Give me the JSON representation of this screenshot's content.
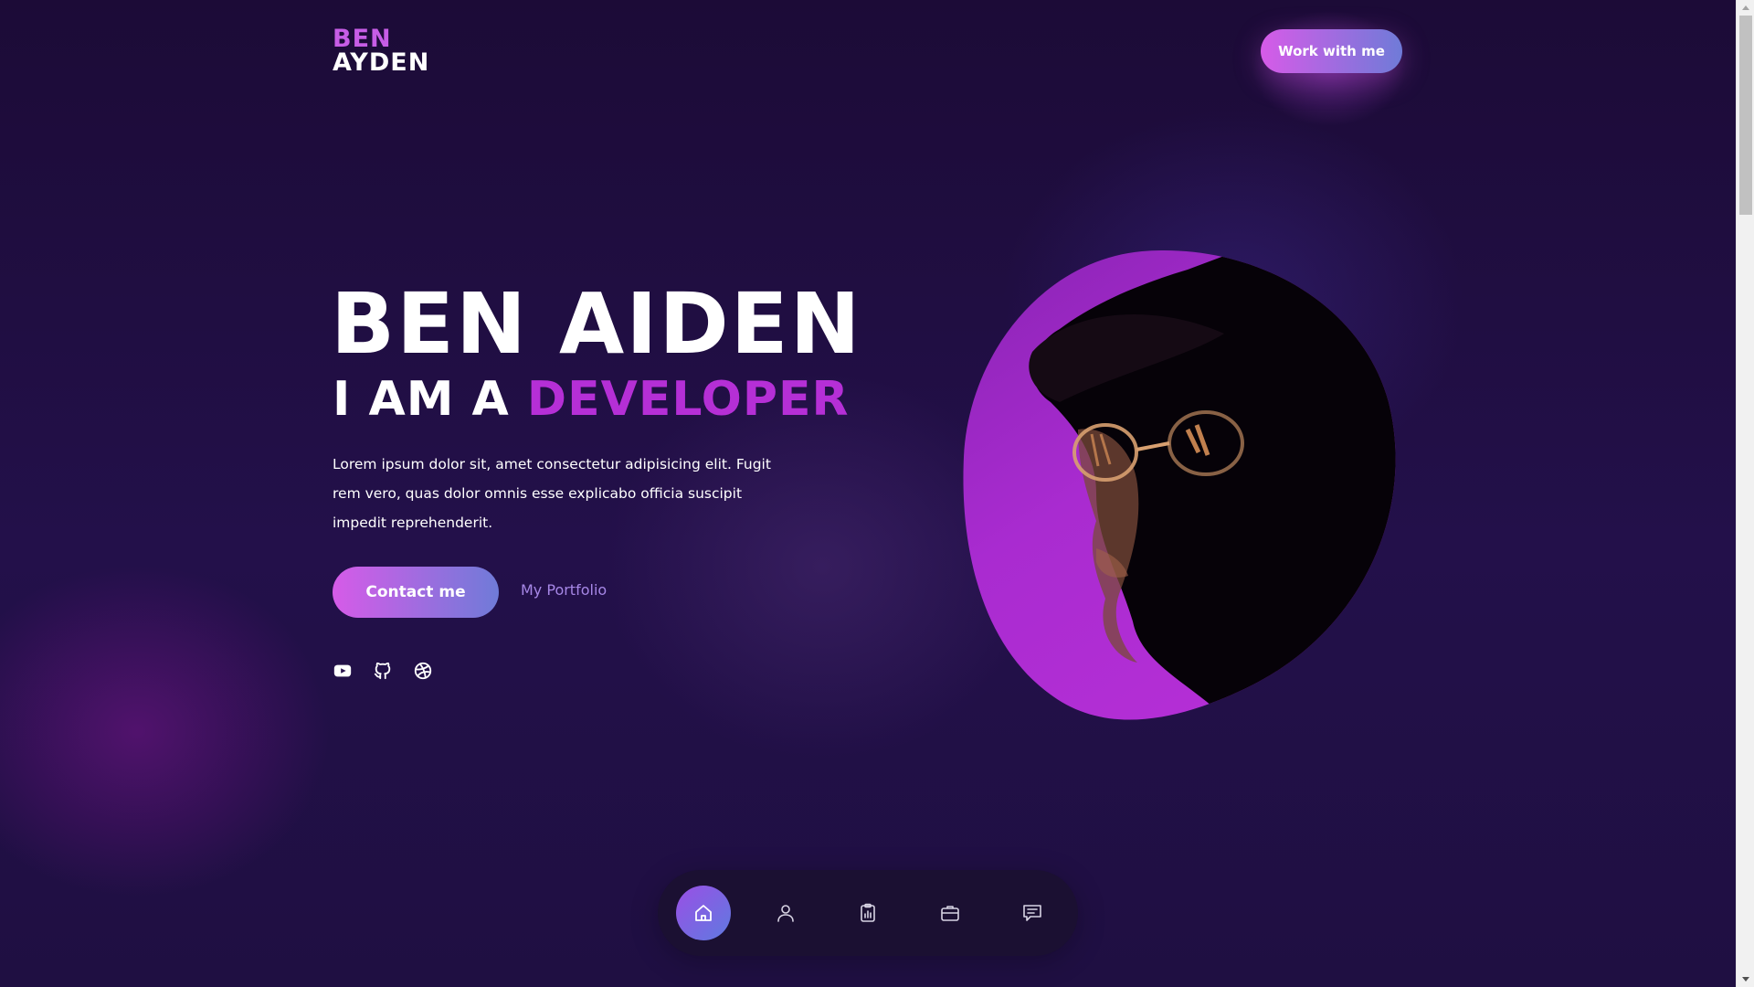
{
  "header": {
    "logo_first": "BEN",
    "logo_last": "AYDEN",
    "cta_label": "Work with me"
  },
  "hero": {
    "name": "BEN AIDEN",
    "subtitle_prefix": "I AM A",
    "subtitle_role": "DEVELOPER",
    "description": "Lorem ipsum dolor sit, amet consectetur adipisicing elit. Fugit rem vero, quas dolor omnis esse explicabo officia suscipit impedit reprehenderit.",
    "primary_button": "Contact me",
    "secondary_link": "My Portfolio"
  },
  "socials": [
    {
      "icon": "youtube-icon"
    },
    {
      "icon": "github-icon"
    },
    {
      "icon": "dribbble-icon"
    }
  ],
  "bottom_nav": {
    "items": [
      {
        "icon": "home-icon",
        "active": true
      },
      {
        "icon": "user-icon",
        "active": false
      },
      {
        "icon": "clipboard-chart-icon",
        "active": false
      },
      {
        "icon": "briefcase-icon",
        "active": false
      },
      {
        "icon": "message-icon",
        "active": false
      }
    ]
  },
  "colors": {
    "background": "#1d0e3c",
    "accent_pink": "#d65be8",
    "accent_blue": "#6f7bd8",
    "role_text": "#b52fd6",
    "link_text": "#a687e6",
    "nav_bg": "#1b1032"
  }
}
